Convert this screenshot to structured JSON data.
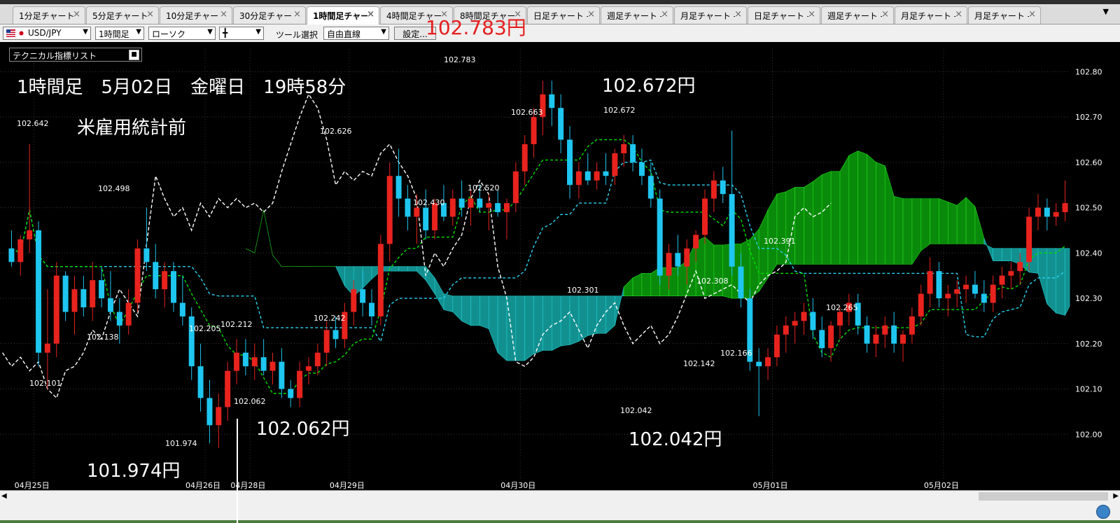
{
  "tabs": [
    {
      "label": "1分足チャート",
      "active": false
    },
    {
      "label": "5分足チャート",
      "active": false
    },
    {
      "label": "10分足チャート",
      "active": false
    },
    {
      "label": "30分足チャート",
      "active": false
    },
    {
      "label": "1時間足チャート",
      "active": true
    },
    {
      "label": "4時間足チャート",
      "active": false
    },
    {
      "label": "8時間足チャート",
      "active": false
    },
    {
      "label": "日足チャート -",
      "active": false
    },
    {
      "label": "週足チャート -",
      "active": false
    },
    {
      "label": "月足チャート -",
      "active": false
    },
    {
      "label": "日足チャート -",
      "active": false
    },
    {
      "label": "週足チャート -",
      "active": false
    },
    {
      "label": "月足チャート -",
      "active": false
    },
    {
      "label": "月足チャート -",
      "active": false
    }
  ],
  "tab_close_glyph": "×",
  "tab_menu_glyph": "▼",
  "toolbar": {
    "pair": "USD/JPY",
    "timeframe": "1時間足",
    "chart_type": "ローソク",
    "line_style_glyph": "╋",
    "tool_label": "ツール選択",
    "tool_value": "自由直線",
    "settings_label": "設定..."
  },
  "indicator_panel": {
    "label": "テクニカル指標リスト",
    "button_glyph": "■"
  },
  "annotations": {
    "header_line": "1時間足　5月02日　金曜日　19時58分",
    "subtitle": "米雇用統計前",
    "high_price_red": "102.783円",
    "price_102672": "102.672円",
    "price_102062": "102.062円",
    "price_102042": "102.042円",
    "price_101974": "101.974円"
  },
  "colors": {
    "candle_up": "#e8231e",
    "candle_down": "#1ec6f0",
    "cloud_bull": "#0a8a0a",
    "cloud_bear": "#129090",
    "tenkan": "#00e000",
    "kijun": "#2ad4f0",
    "chikou": "#ffffff",
    "grid": "#3a3a3a"
  },
  "chart_data": {
    "type": "candlestick",
    "instrument": "USD/JPY",
    "timeframe": "1時間足",
    "y_ticks": [
      "102.80",
      "102.70",
      "102.60",
      "102.50",
      "102.40",
      "102.30",
      "102.20",
      "102.10",
      "102.00"
    ],
    "ylim": [
      101.9,
      102.85
    ],
    "x_ticks": [
      "04月25日",
      "04月26日",
      "04月28日",
      "04月29日",
      "04月30日",
      "05月01日",
      "05月02日"
    ],
    "price_labels": [
      "102.642",
      "102.498",
      "102.138",
      "102.101",
      "101.974",
      "102.205",
      "102.212",
      "102.062",
      "102.626",
      "102.242",
      "102.783",
      "102.430",
      "102.520",
      "102.663",
      "102.672",
      "102.301",
      "102.042",
      "102.308",
      "102.142",
      "102.166",
      "102.391",
      "102.265"
    ],
    "series": [
      {
        "name": "ローソク足",
        "points": [
          {
            "o": 102.41,
            "h": 102.45,
            "l": 102.37,
            "c": 102.38
          },
          {
            "o": 102.38,
            "h": 102.44,
            "l": 102.35,
            "c": 102.43
          },
          {
            "o": 102.43,
            "h": 102.64,
            "l": 102.4,
            "c": 102.45
          },
          {
            "o": 102.45,
            "h": 102.47,
            "l": 102.15,
            "c": 102.18
          },
          {
            "o": 102.18,
            "h": 102.32,
            "l": 102.1,
            "c": 102.2
          },
          {
            "o": 102.2,
            "h": 102.38,
            "l": 102.17,
            "c": 102.35
          },
          {
            "o": 102.35,
            "h": 102.36,
            "l": 102.25,
            "c": 102.27
          },
          {
            "o": 102.27,
            "h": 102.35,
            "l": 102.22,
            "c": 102.32
          },
          {
            "o": 102.32,
            "h": 102.35,
            "l": 102.26,
            "c": 102.28
          },
          {
            "o": 102.28,
            "h": 102.38,
            "l": 102.25,
            "c": 102.34
          },
          {
            "o": 102.34,
            "h": 102.37,
            "l": 102.28,
            "c": 102.3
          },
          {
            "o": 102.3,
            "h": 102.36,
            "l": 102.25,
            "c": 102.27
          },
          {
            "o": 102.27,
            "h": 102.3,
            "l": 102.2,
            "c": 102.24
          },
          {
            "o": 102.24,
            "h": 102.32,
            "l": 102.22,
            "c": 102.29
          },
          {
            "o": 102.29,
            "h": 102.43,
            "l": 102.27,
            "c": 102.41
          },
          {
            "o": 102.41,
            "h": 102.5,
            "l": 102.36,
            "c": 102.38
          },
          {
            "o": 102.38,
            "h": 102.42,
            "l": 102.3,
            "c": 102.32
          },
          {
            "o": 102.32,
            "h": 102.38,
            "l": 102.28,
            "c": 102.36
          },
          {
            "o": 102.36,
            "h": 102.38,
            "l": 102.27,
            "c": 102.29
          },
          {
            "o": 102.29,
            "h": 102.35,
            "l": 102.24,
            "c": 102.26
          },
          {
            "o": 102.26,
            "h": 102.28,
            "l": 102.12,
            "c": 102.15
          },
          {
            "o": 102.15,
            "h": 102.2,
            "l": 102.05,
            "c": 102.08
          },
          {
            "o": 102.08,
            "h": 102.12,
            "l": 101.98,
            "c": 102.02
          },
          {
            "o": 102.02,
            "h": 102.09,
            "l": 101.97,
            "c": 102.06
          },
          {
            "o": 102.06,
            "h": 102.16,
            "l": 102.03,
            "c": 102.14
          },
          {
            "o": 102.14,
            "h": 102.21,
            "l": 102.11,
            "c": 102.18
          },
          {
            "o": 102.18,
            "h": 102.21,
            "l": 102.13,
            "c": 102.15
          },
          {
            "o": 102.15,
            "h": 102.2,
            "l": 102.12,
            "c": 102.17
          },
          {
            "o": 102.17,
            "h": 102.21,
            "l": 102.13,
            "c": 102.14
          },
          {
            "o": 102.14,
            "h": 102.18,
            "l": 102.11,
            "c": 102.16
          },
          {
            "o": 102.16,
            "h": 102.19,
            "l": 102.08,
            "c": 102.1
          },
          {
            "o": 102.1,
            "h": 102.12,
            "l": 102.06,
            "c": 102.08
          },
          {
            "o": 102.08,
            "h": 102.16,
            "l": 102.06,
            "c": 102.14
          },
          {
            "o": 102.14,
            "h": 102.17,
            "l": 102.11,
            "c": 102.15
          },
          {
            "o": 102.15,
            "h": 102.2,
            "l": 102.13,
            "c": 102.18
          },
          {
            "o": 102.18,
            "h": 102.25,
            "l": 102.15,
            "c": 102.23
          },
          {
            "o": 102.23,
            "h": 102.26,
            "l": 102.19,
            "c": 102.21
          },
          {
            "o": 102.21,
            "h": 102.29,
            "l": 102.19,
            "c": 102.27
          },
          {
            "o": 102.27,
            "h": 102.34,
            "l": 102.24,
            "c": 102.32
          },
          {
            "o": 102.32,
            "h": 102.36,
            "l": 102.26,
            "c": 102.29
          },
          {
            "o": 102.29,
            "h": 102.32,
            "l": 102.24,
            "c": 102.26
          },
          {
            "o": 102.26,
            "h": 102.44,
            "l": 102.24,
            "c": 102.42
          },
          {
            "o": 102.42,
            "h": 102.6,
            "l": 102.38,
            "c": 102.57
          },
          {
            "o": 102.57,
            "h": 102.63,
            "l": 102.48,
            "c": 102.52
          },
          {
            "o": 102.52,
            "h": 102.55,
            "l": 102.45,
            "c": 102.48
          },
          {
            "o": 102.48,
            "h": 102.53,
            "l": 102.42,
            "c": 102.5
          },
          {
            "o": 102.5,
            "h": 102.54,
            "l": 102.43,
            "c": 102.45
          },
          {
            "o": 102.45,
            "h": 102.52,
            "l": 102.43,
            "c": 102.51
          },
          {
            "o": 102.51,
            "h": 102.55,
            "l": 102.47,
            "c": 102.48
          },
          {
            "o": 102.48,
            "h": 102.54,
            "l": 102.46,
            "c": 102.52
          },
          {
            "o": 102.52,
            "h": 102.56,
            "l": 102.48,
            "c": 102.5
          },
          {
            "o": 102.5,
            "h": 102.54,
            "l": 102.46,
            "c": 102.52
          },
          {
            "o": 102.52,
            "h": 102.55,
            "l": 102.49,
            "c": 102.5
          },
          {
            "o": 102.5,
            "h": 102.53,
            "l": 102.45,
            "c": 102.51
          },
          {
            "o": 102.51,
            "h": 102.54,
            "l": 102.48,
            "c": 102.49
          },
          {
            "o": 102.49,
            "h": 102.52,
            "l": 102.43,
            "c": 102.51
          },
          {
            "o": 102.51,
            "h": 102.6,
            "l": 102.49,
            "c": 102.58
          },
          {
            "o": 102.58,
            "h": 102.66,
            "l": 102.55,
            "c": 102.64
          },
          {
            "o": 102.64,
            "h": 102.72,
            "l": 102.61,
            "c": 102.7
          },
          {
            "o": 102.7,
            "h": 102.78,
            "l": 102.66,
            "c": 102.75
          },
          {
            "o": 102.75,
            "h": 102.78,
            "l": 102.68,
            "c": 102.72
          },
          {
            "o": 102.72,
            "h": 102.75,
            "l": 102.62,
            "c": 102.65
          },
          {
            "o": 102.65,
            "h": 102.68,
            "l": 102.52,
            "c": 102.55
          },
          {
            "o": 102.55,
            "h": 102.6,
            "l": 102.52,
            "c": 102.58
          },
          {
            "o": 102.58,
            "h": 102.62,
            "l": 102.55,
            "c": 102.56
          },
          {
            "o": 102.56,
            "h": 102.6,
            "l": 102.54,
            "c": 102.58
          },
          {
            "o": 102.58,
            "h": 102.62,
            "l": 102.55,
            "c": 102.57
          },
          {
            "o": 102.57,
            "h": 102.63,
            "l": 102.55,
            "c": 102.62
          },
          {
            "o": 102.62,
            "h": 102.66,
            "l": 102.59,
            "c": 102.64
          },
          {
            "o": 102.64,
            "h": 102.66,
            "l": 102.58,
            "c": 102.6
          },
          {
            "o": 102.6,
            "h": 102.63,
            "l": 102.55,
            "c": 102.57
          },
          {
            "o": 102.57,
            "h": 102.6,
            "l": 102.5,
            "c": 102.52
          },
          {
            "o": 102.52,
            "h": 102.54,
            "l": 102.33,
            "c": 102.35
          },
          {
            "o": 102.35,
            "h": 102.42,
            "l": 102.32,
            "c": 102.4
          },
          {
            "o": 102.4,
            "h": 102.44,
            "l": 102.35,
            "c": 102.37
          },
          {
            "o": 102.37,
            "h": 102.43,
            "l": 102.33,
            "c": 102.41
          },
          {
            "o": 102.41,
            "h": 102.45,
            "l": 102.38,
            "c": 102.44
          },
          {
            "o": 102.44,
            "h": 102.54,
            "l": 102.42,
            "c": 102.52
          },
          {
            "o": 102.52,
            "h": 102.58,
            "l": 102.49,
            "c": 102.56
          },
          {
            "o": 102.56,
            "h": 102.59,
            "l": 102.51,
            "c": 102.53
          },
          {
            "o": 102.53,
            "h": 102.67,
            "l": 102.35,
            "c": 102.37
          },
          {
            "o": 102.37,
            "h": 102.4,
            "l": 102.28,
            "c": 102.3
          },
          {
            "o": 102.3,
            "h": 102.32,
            "l": 102.14,
            "c": 102.16
          },
          {
            "o": 102.16,
            "h": 102.19,
            "l": 102.04,
            "c": 102.15
          },
          {
            "o": 102.15,
            "h": 102.19,
            "l": 102.12,
            "c": 102.17
          },
          {
            "o": 102.17,
            "h": 102.24,
            "l": 102.15,
            "c": 102.22
          },
          {
            "o": 102.22,
            "h": 102.26,
            "l": 102.18,
            "c": 102.24
          },
          {
            "o": 102.24,
            "h": 102.27,
            "l": 102.2,
            "c": 102.25
          },
          {
            "o": 102.25,
            "h": 102.29,
            "l": 102.22,
            "c": 102.27
          },
          {
            "o": 102.27,
            "h": 102.3,
            "l": 102.21,
            "c": 102.23
          },
          {
            "o": 102.23,
            "h": 102.26,
            "l": 102.17,
            "c": 102.19
          },
          {
            "o": 102.19,
            "h": 102.25,
            "l": 102.16,
            "c": 102.24
          },
          {
            "o": 102.24,
            "h": 102.28,
            "l": 102.21,
            "c": 102.27
          },
          {
            "o": 102.27,
            "h": 102.31,
            "l": 102.24,
            "c": 102.29
          },
          {
            "o": 102.29,
            "h": 102.31,
            "l": 102.22,
            "c": 102.24
          },
          {
            "o": 102.24,
            "h": 102.26,
            "l": 102.18,
            "c": 102.2
          },
          {
            "o": 102.2,
            "h": 102.24,
            "l": 102.17,
            "c": 102.22
          },
          {
            "o": 102.22,
            "h": 102.26,
            "l": 102.19,
            "c": 102.24
          },
          {
            "o": 102.24,
            "h": 102.27,
            "l": 102.18,
            "c": 102.2
          },
          {
            "o": 102.2,
            "h": 102.23,
            "l": 102.16,
            "c": 102.22
          },
          {
            "o": 102.22,
            "h": 102.28,
            "l": 102.2,
            "c": 102.26
          },
          {
            "o": 102.26,
            "h": 102.33,
            "l": 102.24,
            "c": 102.31
          },
          {
            "o": 102.31,
            "h": 102.39,
            "l": 102.28,
            "c": 102.36
          },
          {
            "o": 102.36,
            "h": 102.38,
            "l": 102.28,
            "c": 102.3
          },
          {
            "o": 102.3,
            "h": 102.33,
            "l": 102.26,
            "c": 102.31
          },
          {
            "o": 102.31,
            "h": 102.34,
            "l": 102.28,
            "c": 102.32
          },
          {
            "o": 102.32,
            "h": 102.35,
            "l": 102.29,
            "c": 102.33
          },
          {
            "o": 102.33,
            "h": 102.36,
            "l": 102.3,
            "c": 102.31
          },
          {
            "o": 102.31,
            "h": 102.34,
            "l": 102.27,
            "c": 102.29
          },
          {
            "o": 102.29,
            "h": 102.35,
            "l": 102.27,
            "c": 102.33
          },
          {
            "o": 102.33,
            "h": 102.37,
            "l": 102.3,
            "c": 102.35
          },
          {
            "o": 102.35,
            "h": 102.38,
            "l": 102.32,
            "c": 102.36
          },
          {
            "o": 102.36,
            "h": 102.4,
            "l": 102.33,
            "c": 102.38
          },
          {
            "o": 102.38,
            "h": 102.5,
            "l": 102.36,
            "c": 102.48
          },
          {
            "o": 102.48,
            "h": 102.53,
            "l": 102.45,
            "c": 102.5
          },
          {
            "o": 102.5,
            "h": 102.52,
            "l": 102.45,
            "c": 102.48
          },
          {
            "o": 102.48,
            "h": 102.51,
            "l": 102.46,
            "c": 102.49
          },
          {
            "o": 102.49,
            "h": 102.56,
            "l": 102.47,
            "c": 102.51
          }
        ]
      }
    ]
  }
}
